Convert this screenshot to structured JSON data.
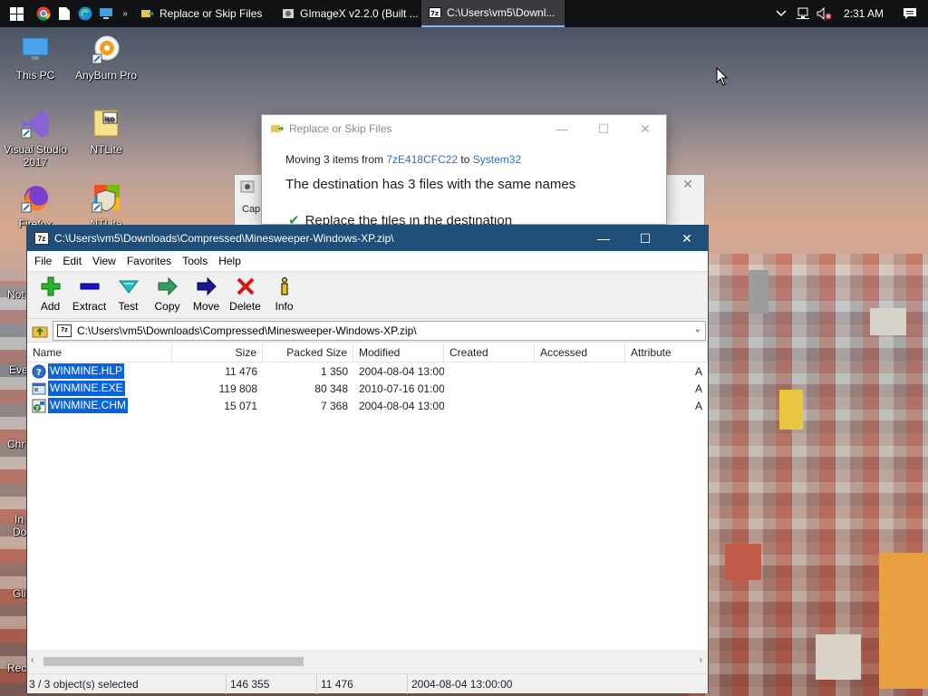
{
  "taskbar": {
    "tasks": [
      {
        "label": "Replace or Skip Files"
      },
      {
        "label": "GImageX v2.2.0 (Built ..."
      },
      {
        "label": "C:\\Users\\vm5\\Downl..."
      }
    ],
    "clock": "2:31 AM"
  },
  "desktop": {
    "icons": [
      {
        "label": "This PC"
      },
      {
        "label": "AnyBurn Pro"
      },
      {
        "label": "Visual Studio 2017"
      },
      {
        "label": "NTLite"
      },
      {
        "label": "Firefox"
      },
      {
        "label": "NTLite"
      }
    ],
    "partial_labels": [
      "Not",
      "Eve",
      "Chr",
      "In",
      "Do",
      "Gli",
      "Rec"
    ]
  },
  "replace_dialog": {
    "title": "Replace or Skip Files",
    "moving_prefix": "Moving 3 items from ",
    "from": "7zE418CFC22",
    "to_word": " to ",
    "to": "System32",
    "heading": "The destination has 3 files with the same names",
    "option1": "Replace the files in the destination"
  },
  "gimagex": {
    "caption": "Cap"
  },
  "zip": {
    "title": "C:\\Users\\vm5\\Downloads\\Compressed\\Minesweeper-Windows-XP.zip\\",
    "menu": [
      "File",
      "Edit",
      "View",
      "Favorites",
      "Tools",
      "Help"
    ],
    "toolbar": [
      {
        "label": "Add",
        "icon": "add-icon"
      },
      {
        "label": "Extract",
        "icon": "extract-icon"
      },
      {
        "label": "Test",
        "icon": "test-icon"
      },
      {
        "label": "Copy",
        "icon": "copy-icon"
      },
      {
        "label": "Move",
        "icon": "move-icon"
      },
      {
        "label": "Delete",
        "icon": "delete-icon"
      },
      {
        "label": "Info",
        "icon": "info-icon"
      }
    ],
    "address": "C:\\Users\\vm5\\Downloads\\Compressed\\Minesweeper-Windows-XP.zip\\",
    "columns": [
      "Name",
      "Size",
      "Packed Size",
      "Modified",
      "Created",
      "Accessed",
      "Attribute"
    ],
    "rows": [
      {
        "name": "WINMINE.HLP",
        "size": "11 476",
        "packed": "1 350",
        "modified": "2004-08-04 13:00",
        "attr": "A",
        "icon": "help-file-icon"
      },
      {
        "name": "WINMINE.EXE",
        "size": "119 808",
        "packed": "80 348",
        "modified": "2010-07-16 01:00",
        "attr": "A",
        "icon": "exe-file-icon"
      },
      {
        "name": "WINMINE.CHM",
        "size": "15 071",
        "packed": "7 368",
        "modified": "2004-08-04 13:00",
        "attr": "A",
        "icon": "chm-file-icon"
      }
    ],
    "status": {
      "selected": "3 / 3 object(s) selected",
      "total": "146 355",
      "sel_size": "11 476",
      "date": "2004-08-04 13:00:00"
    }
  }
}
